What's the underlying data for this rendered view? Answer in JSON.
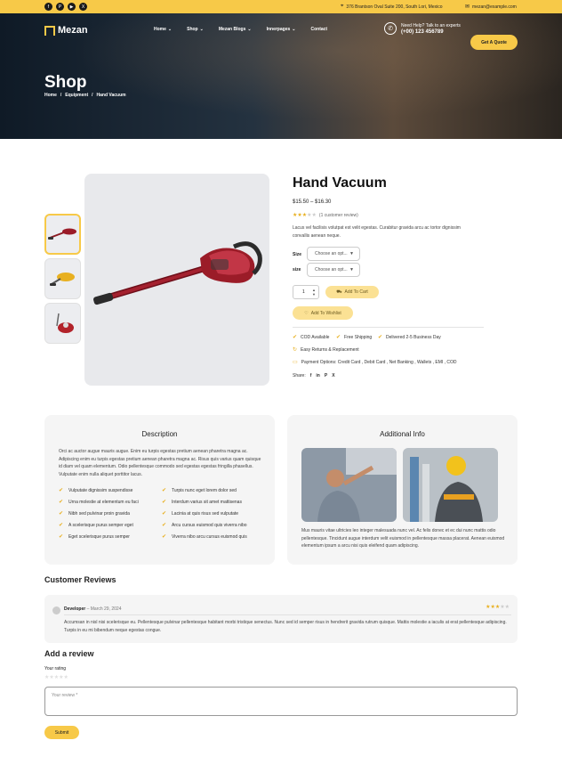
{
  "topbar": {
    "social": [
      "f",
      "P",
      "▶",
      "X"
    ],
    "address": "376 Brantson Oval Suite 200, South Lori, Mexico",
    "email": "mezan@example.com"
  },
  "header": {
    "brand": "Mezan",
    "nav": [
      {
        "label": "Home",
        "has_dropdown": true
      },
      {
        "label": "Shop",
        "has_dropdown": true
      },
      {
        "label": "Mezan Blogs",
        "has_dropdown": true
      },
      {
        "label": "Innerpages",
        "has_dropdown": true
      },
      {
        "label": "Contact",
        "has_dropdown": false
      }
    ],
    "help_label": "Need Help? Talk to an experts",
    "help_phone": "(+00) 123 456789",
    "quote_button": "Get A Quote"
  },
  "hero": {
    "title": "Shop",
    "breadcrumb": [
      "Home",
      "Equipment",
      "Hand Vacuum"
    ]
  },
  "product": {
    "title": "Hand Vacuum",
    "price": "$15.50 – $16.30",
    "rating": 3,
    "rating_max": 5,
    "reviews_text": "(1 customer review)",
    "description": "Lacus vel facilisis volutpat est velit egestas. Curabitur gravida arcu ac tortor dignissim convallis aenean neque.",
    "variations": [
      {
        "label": "Size",
        "placeholder": "Choose an opt..."
      },
      {
        "label": "size",
        "placeholder": "Choose an opt..."
      }
    ],
    "quantity": "1",
    "add_to_cart": "Add To Cart",
    "add_to_wishlist": "Add To Wishlist",
    "features": [
      "COD Available",
      "Free Shipping",
      "Delivered 2-5 Business Day",
      "Easy Returns & Replacement",
      "Payment Options: Credit Card , Debit Card , Net Banking , Wallets , EMI , COD"
    ],
    "share_label": "Share:",
    "share_icons": [
      "f",
      "in",
      "P",
      "X"
    ]
  },
  "description_card": {
    "title": "Description",
    "text": "Orci ac auctor augue mauris augue. Enim eu turpis egestas pretium aenean pharetra magna ac. Adipiscing enim eu turpis egestas pretium aenean pharetra magna ac. Risus quis varius quam quisque id diam vel quam elementum. Odio pellentesque commodo sed egestas egestas fringilla phasellus. Vulputate enim nulla aliquet porttitor lacus.",
    "bullets_left": [
      "Vulputate dignissim suspendisse",
      "Urna molestie at elementum eu faci",
      "Nibh sed pulvinar proin gravida",
      "A scelerisque purus semper eget",
      "Eget scelerisque purus semper"
    ],
    "bullets_right": [
      "Turpis nunc eget lorem dolor sed",
      "Interdum varius sit amet mattisenas",
      "Lacinia at quis risus sed vulputate",
      "Arcu cursus euismod quis viverra nibo",
      "Viverra nibo arcu cursus euismod quis"
    ]
  },
  "additional_card": {
    "title": "Additional Info",
    "text": "Mus mauris vitae ultricies leo integer malesuada nunc vel. Ac felis donec et ec dui nunc mattis odio pellentesque. Tincidunt augue interdum velit euismod in pellentesque massa placerat. Aenean euismod elementum ipsum a arcu nisi quis eleifend quam adipiscing."
  },
  "reviews": {
    "heading": "Customer Reviews",
    "items": [
      {
        "author": "Developer",
        "date": "– March 29, 2024",
        "rating": 3,
        "text": "Accumsan in nisl nisi scelerisque eu. Pellentesque pulvinar pellentesque habitant morbi tristique senectus. Nunc sed id semper risus in hendrerit gravida rutrum quisque. Mattis molestie a iaculis at erat pellentesque adipiscing. Turpis in eu mi bibendum neque egestas congue."
      }
    ]
  },
  "review_form": {
    "heading": "Add a review",
    "rating_label": "Your rating",
    "textarea_placeholder": "Your review *",
    "submit_label": "Submit"
  },
  "colors": {
    "accent": "#f7c948",
    "accent_light": "#fbe194",
    "dark": "#1a1a1a",
    "card_bg": "#f5f5f5"
  }
}
